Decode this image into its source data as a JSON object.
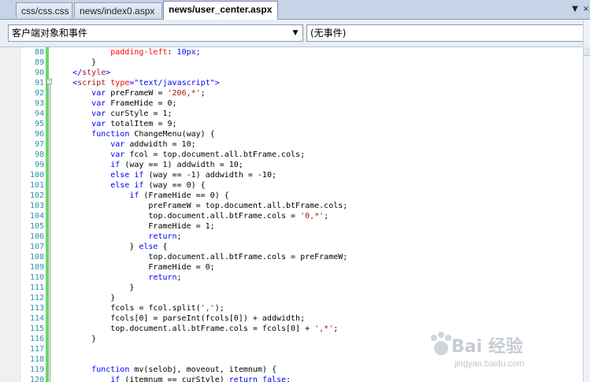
{
  "tabs": [
    {
      "label": "css/css.css",
      "active": false
    },
    {
      "label": "news/index0.aspx",
      "active": false
    },
    {
      "label": "news/user_center.aspx",
      "active": true
    }
  ],
  "tab_controls": {
    "dropdown_glyph": "▼",
    "close_glyph": "×"
  },
  "object_dropdown": {
    "value": "客户端对象和事件"
  },
  "event_dropdown": {
    "value": "(无事件)"
  },
  "line_numbers": [
    "88",
    "89",
    "90",
    "91",
    "92",
    "93",
    "94",
    "95",
    "96",
    "97",
    "98",
    "99",
    "100",
    "101",
    "102",
    "103",
    "104",
    "105",
    "106",
    "107",
    "108",
    "109",
    "110",
    "111",
    "112",
    "113",
    "114",
    "115",
    "116",
    "117",
    "118",
    "119",
    "120"
  ],
  "code_lines": [
    "            padding-left: 10px;",
    "        }",
    "    </style>",
    "    <script type=\"text/javascript\">",
    "        var preFrameW = '206,*';",
    "        var FrameHide = 0;",
    "        var curStyle = 1;",
    "        var totalItem = 9;",
    "        function ChangeMenu(way) {",
    "            var addwidth = 10;",
    "            var fcol = top.document.all.btFrame.cols;",
    "            if (way == 1) addwidth = 10;",
    "            else if (way == -1) addwidth = -10;",
    "            else if (way == 0) {",
    "                if (FrameHide == 0) {",
    "                    preFrameW = top.document.all.btFrame.cols;",
    "                    top.document.all.btFrame.cols = '0,*';",
    "                    FrameHide = 1;",
    "                    return;",
    "                } else {",
    "                    top.document.all.btFrame.cols = preFrameW;",
    "                    FrameHide = 0;",
    "                    return;",
    "                }",
    "            }",
    "            fcols = fcol.split(',');",
    "            fcols[0] = parseInt(fcols[0]) + addwidth;",
    "            top.document.all.btFrame.cols = fcols[0] + ',*';",
    "        }",
    "",
    "",
    "        function mv(selobj, moveout, itemnum) {",
    "            if (itemnum == curStyle) return false;"
  ],
  "colors": {
    "keyword": "#0000ff",
    "string": "#a31515",
    "tag": "#a31515",
    "attribute": "#ff0000",
    "line_number": "#2b91af",
    "change_margin": "#6fd46f"
  },
  "watermark": {
    "logo_text": "Bai 经验",
    "url": "jingyan.baidu.com"
  }
}
